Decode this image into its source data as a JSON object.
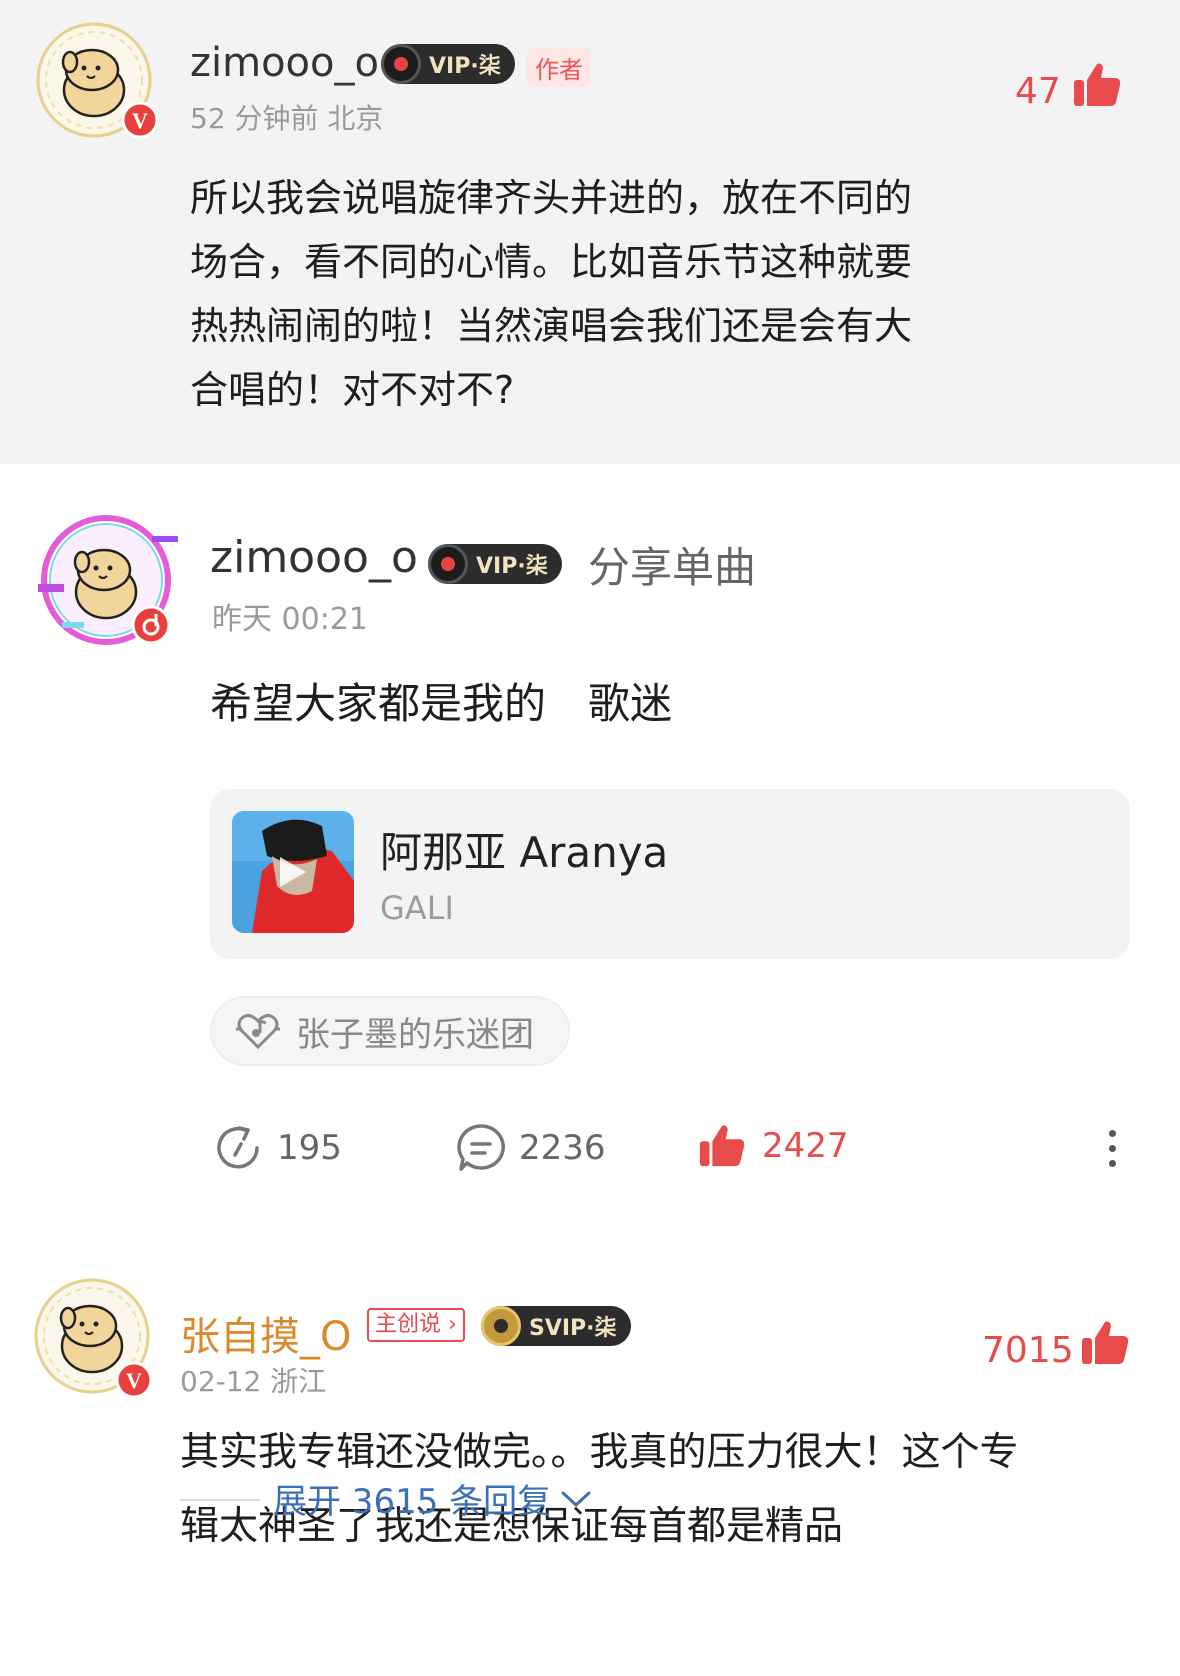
{
  "reply_comment": {
    "username": "zimooo_o",
    "vip_label": "VIP·柒",
    "author_tag": "作者",
    "meta": "52 分钟前 北京",
    "likes": "47",
    "text": "所以我会说唱旋律齐头并进的，放在不同的场合，看不同的心情。比如音乐节这种就要热热闹闹的啦！当然演唱会我们还是会有大合唱的！对不对不?",
    "text_lines": [
      "所以我会说唱旋律齐头并进的，放在不同的",
      "场合，看不同的心情。比如音乐节这种就要",
      "热热闹闹的啦！当然演唱会我们还是会有大",
      "合唱的！对不对不?"
    ]
  },
  "post": {
    "username": "zimooo_o",
    "vip_label": "VIP·柒",
    "action_text": "分享单曲",
    "meta": "昨天 00:21",
    "text": "希望大家都是我的　歌迷",
    "song": {
      "title": "阿那亚 Aranya",
      "artist": "GALI"
    },
    "fan_group": "张子墨的乐迷团",
    "shares": "195",
    "comments": "2236",
    "likes": "2427"
  },
  "top_comment": {
    "username": "张自摸_O",
    "creator_tag": "主创说",
    "svip_label": "SVIP·柒",
    "meta": "02-12 浙江",
    "likes": "7015",
    "text_lines": [
      "其实我专辑还没做完。。我真的压力很大！这个专",
      "辑太神圣了我还是想保证每首都是精品"
    ],
    "expand_label": "展开 3615 条回复"
  },
  "colors": {
    "accent_red": "#e84b4b",
    "link_blue": "#3b6fb6",
    "username_orange": "#d98a2b"
  }
}
